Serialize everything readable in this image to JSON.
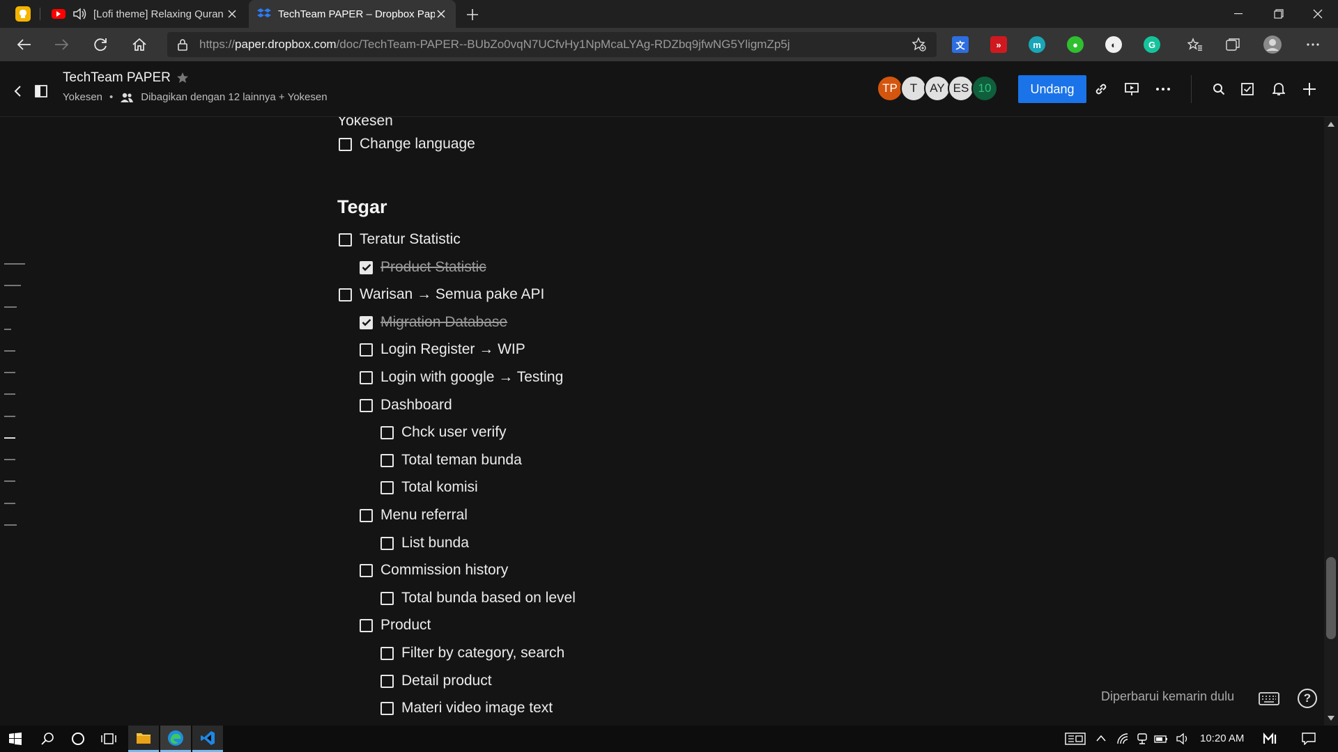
{
  "browser": {
    "tabs": [
      {
        "title": "[Lofi theme] Relaxing Quran",
        "icon": "youtube-icon",
        "audio": true
      },
      {
        "title": "TechTeam PAPER – Dropbox Paper",
        "icon": "dropbox-paper-icon",
        "active": true
      }
    ],
    "url": {
      "scheme": "https://",
      "host": "paper.dropbox.com",
      "path": "/doc/TechTeam-PAPER--BUbZo0vqN7UCfvHy1NpMcaLYAg-RDZbq9jfwNG5YligmZp5j"
    },
    "extensions": [
      "translate-icon",
      "red-extension-icon",
      "m-extension-icon",
      "green-extension-icon",
      "white-extension-icon",
      "grammarly-icon"
    ]
  },
  "paper": {
    "doc_title": "TechTeam PAPER",
    "owner": "Yokesen",
    "shared": "Dibagikan dengan 12 lainnya + Yokesen",
    "avatars": [
      {
        "initials": "TP",
        "color": "#d4560e",
        "text": "#ffffff"
      },
      {
        "initials": "T",
        "color": "#e0e0e0",
        "text": "#202020"
      },
      {
        "initials": "AY",
        "color": "#e0e0e0",
        "text": "#202020"
      },
      {
        "initials": "ES",
        "color": "#e0e0e0",
        "text": "#202020"
      },
      {
        "initials": "10",
        "color": "#0f5e3c",
        "text": "#2fbf7f"
      }
    ],
    "invite_label": "Undang",
    "accent": "#1a73e8"
  },
  "document": {
    "prev_name": "Yokesen",
    "prev_tasks": [
      {
        "text": "Change language",
        "checked": false,
        "level": 0
      }
    ],
    "section_title": "Tegar",
    "tasks": [
      {
        "text": "Teratur Statistic",
        "checked": false,
        "level": 0
      },
      {
        "text": "Product Statistic",
        "checked": true,
        "level": 1
      },
      {
        "text": "Warisan → Semua pake API",
        "checked": false,
        "level": 0
      },
      {
        "text": "Migration Database",
        "checked": true,
        "level": 1
      },
      {
        "text": "Login Register → WIP",
        "checked": false,
        "level": 1
      },
      {
        "text": "Login with google → Testing",
        "checked": false,
        "level": 1
      },
      {
        "text": "Dashboard",
        "checked": false,
        "level": 1
      },
      {
        "text": "Chck user verify",
        "checked": false,
        "level": 2
      },
      {
        "text": "Total teman bunda",
        "checked": false,
        "level": 2
      },
      {
        "text": "Total komisi",
        "checked": false,
        "level": 2
      },
      {
        "text": "Menu referral",
        "checked": false,
        "level": 1
      },
      {
        "text": "List bunda",
        "checked": false,
        "level": 2
      },
      {
        "text": "Commission history",
        "checked": false,
        "level": 1
      },
      {
        "text": "Total bunda based on level",
        "checked": false,
        "level": 2
      },
      {
        "text": "Product",
        "checked": false,
        "level": 1
      },
      {
        "text": "Filter by category, search",
        "checked": false,
        "level": 2
      },
      {
        "text": "Detail product",
        "checked": false,
        "level": 2
      },
      {
        "text": "Materi video image text",
        "checked": false,
        "level": 2
      }
    ],
    "updated_text": "Diperbarui kemarin dulu"
  },
  "taskbar": {
    "time": "10:20 AM",
    "apps": [
      "start-icon",
      "search-icon",
      "cortana-icon",
      "task-view-icon",
      "file-explorer-icon",
      "edge-icon",
      "vscode-icon"
    ]
  }
}
